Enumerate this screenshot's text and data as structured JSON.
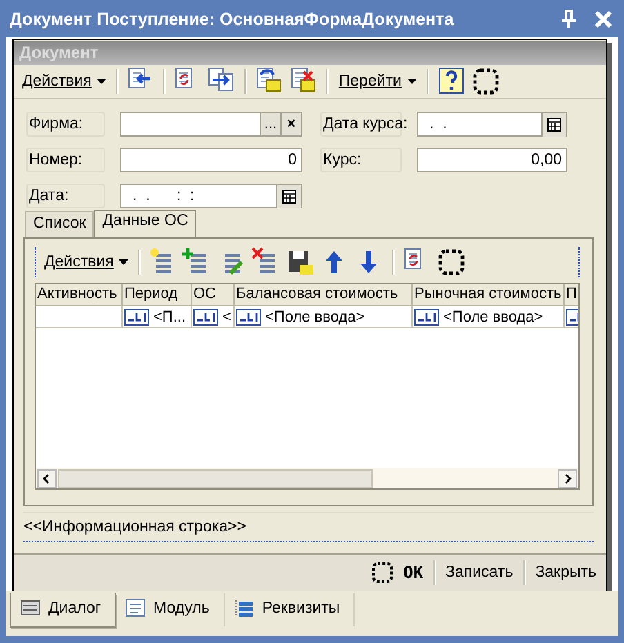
{
  "window": {
    "title": "Документ Поступление: ОсновнаяФормаДокумента"
  },
  "form": {
    "title": "Документ",
    "toolbar": [
      {
        "kind": "menu",
        "label": "Действия"
      },
      {
        "kind": "separator"
      },
      {
        "kind": "button"
      },
      {
        "kind": "separator"
      },
      {
        "kind": "button"
      },
      {
        "kind": "button"
      },
      {
        "kind": "separator"
      },
      {
        "kind": "button"
      },
      {
        "kind": "button"
      },
      {
        "kind": "separator"
      },
      {
        "kind": "menu",
        "label": "Перейти"
      },
      {
        "kind": "separator"
      },
      {
        "kind": "button"
      },
      {
        "kind": "button"
      }
    ],
    "fields": [
      {
        "label": "Фирма:",
        "kind": "reference",
        "select": "...",
        "clear": "×"
      },
      {
        "label": "Дата курса:",
        "kind": "date",
        "value": ".  ."
      },
      {
        "label": "Номер:",
        "kind": "number",
        "value": "0"
      },
      {
        "label": "Курс:",
        "kind": "number",
        "value": "0,00"
      },
      {
        "label": "Дата:",
        "kind": "date",
        "value": ".  .      :  :"
      }
    ],
    "tabs": [
      {
        "label": "Список",
        "selected": false
      },
      {
        "label": "Данные ОС",
        "selected": true
      }
    ],
    "table_toolbar": [
      {
        "kind": "menu",
        "label": "Действия"
      },
      {
        "kind": "separator"
      },
      {
        "kind": "button"
      },
      {
        "kind": "button"
      },
      {
        "kind": "button"
      },
      {
        "kind": "button"
      },
      {
        "kind": "button"
      },
      {
        "kind": "button"
      },
      {
        "kind": "button"
      },
      {
        "kind": "separator"
      },
      {
        "kind": "button"
      },
      {
        "kind": "button"
      }
    ],
    "table": {
      "columns": [
        "Активность",
        "Период",
        "ОС",
        "Балансовая стоимость",
        "Рыночная стоимость",
        "П"
      ],
      "rows": [
        {
          "cells": [
            {
              "input": false
            },
            {
              "input": true,
              "text": "<П..."
            },
            {
              "input": true,
              "text": "<"
            },
            {
              "input": true,
              "text": "<Поле ввода>"
            },
            {
              "input": true,
              "text": "<Поле ввода>"
            },
            {
              "input": true
            }
          ]
        }
      ]
    },
    "info_line": "<<Информационная строка>>",
    "buttons": [
      {
        "kind": "default",
        "label": "OK"
      },
      {
        "kind": "plain",
        "label": "Записать"
      },
      {
        "kind": "plain",
        "label": "Закрыть"
      }
    ]
  },
  "designer_tabs": [
    {
      "label": "Диалог",
      "selected": true
    },
    {
      "label": "Модуль",
      "selected": false
    },
    {
      "label": "Реквизиты",
      "selected": false
    }
  ]
}
